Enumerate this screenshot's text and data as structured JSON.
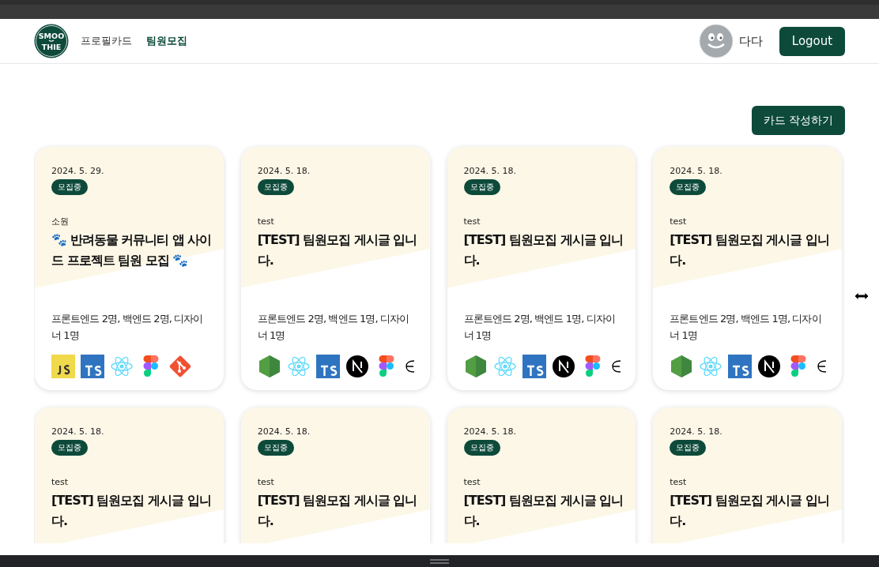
{
  "logo": {
    "lines": [
      "SMOO",
      "THIE"
    ]
  },
  "nav": {
    "links": [
      {
        "label": "프로필카드",
        "selected": false
      },
      {
        "label": "팀원모집",
        "selected": true
      }
    ]
  },
  "user": {
    "name": "다다"
  },
  "logout": "Logout",
  "write_button": "카드 작성하기",
  "cards": [
    {
      "date": "2024. 5. 29.",
      "status": "모집중",
      "author": "소원",
      "title": "🐾 반려동물 커뮤니티 앱 사이드 프로젝트 팀원 모집 🐾",
      "roles": "프론트엔드 2명, 백엔드 2명, 디자이너 1명",
      "stack": [
        {
          "kind": "js"
        },
        {
          "kind": "ts"
        },
        {
          "kind": "react"
        },
        {
          "kind": "figma"
        },
        {
          "kind": "git"
        }
      ]
    },
    {
      "date": "2024. 5. 18.",
      "status": "모집중",
      "author": "test",
      "title": "[TEST] 팀원모집 게시글 입니다.",
      "roles": "프론트엔드 2명, 백엔드 1명, 디자이너 1명",
      "stack": [
        {
          "kind": "node"
        },
        {
          "kind": "react"
        },
        {
          "kind": "ts"
        },
        {
          "kind": "next"
        },
        {
          "kind": "figma"
        },
        {
          "kind": "partial"
        }
      ]
    },
    {
      "date": "2024. 5. 18.",
      "status": "모집중",
      "author": "test",
      "title": "[TEST] 팀원모집 게시글 입니다.",
      "roles": "프론트엔드 2명, 백엔드 1명, 디자이너 1명",
      "stack": [
        {
          "kind": "node"
        },
        {
          "kind": "react"
        },
        {
          "kind": "ts"
        },
        {
          "kind": "next"
        },
        {
          "kind": "figma"
        },
        {
          "kind": "partial"
        }
      ]
    },
    {
      "date": "2024. 5. 18.",
      "status": "모집중",
      "author": "test",
      "title": "[TEST] 팀원모집 게시글 입니다.",
      "roles": "프론트엔드 2명, 백엔드 1명, 디자이너 1명",
      "stack": [
        {
          "kind": "node"
        },
        {
          "kind": "react"
        },
        {
          "kind": "ts"
        },
        {
          "kind": "next"
        },
        {
          "kind": "figma"
        },
        {
          "kind": "partial"
        }
      ]
    },
    {
      "date": "2024. 5. 18.",
      "status": "모집중",
      "author": "test",
      "title": "[TEST] 팀원모집 게시글 입니다."
    },
    {
      "date": "2024. 5. 18.",
      "status": "모집중",
      "author": "test",
      "title": "[TEST] 팀원모집 게시글 입니다."
    },
    {
      "date": "2024. 5. 18.",
      "status": "모집중",
      "author": "test",
      "title": "[TEST] 팀원모집 게시글 입니다."
    },
    {
      "date": "2024. 5. 18.",
      "status": "모집중",
      "author": "test",
      "title": "[TEST] 팀원모집 게시글 입니다."
    }
  ]
}
